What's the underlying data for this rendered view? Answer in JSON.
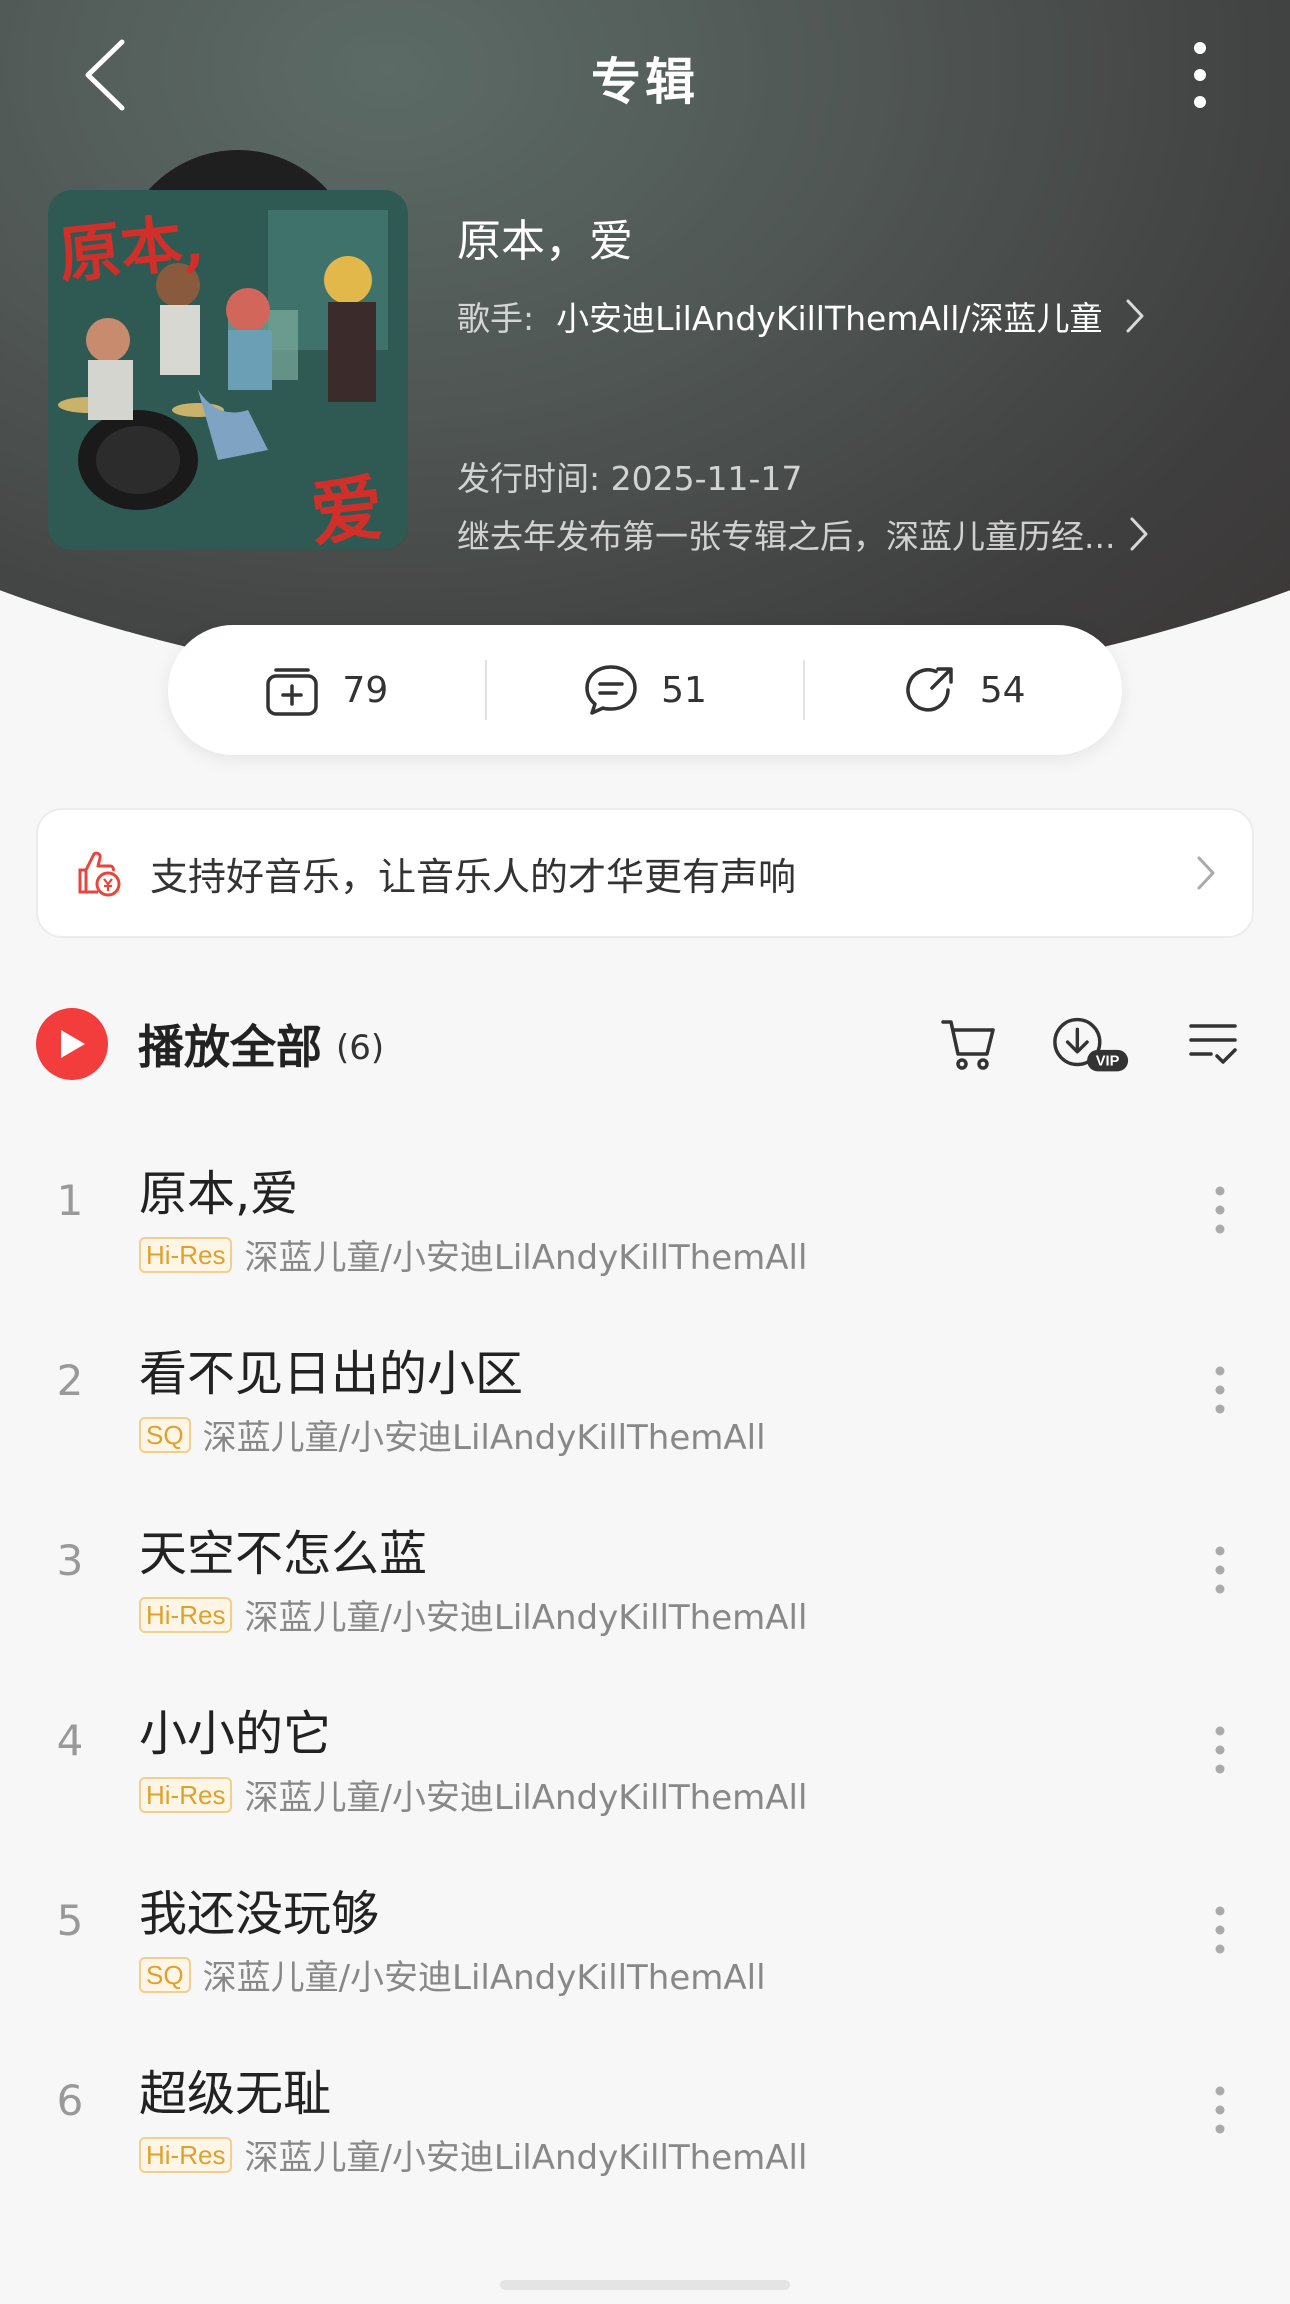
{
  "header": {
    "title": "专辑",
    "back_icon": "chevron-left-icon",
    "more_icon": "vertical-dots-icon"
  },
  "album": {
    "name": "原本，爱",
    "artist_label": "歌手:",
    "artists": "小安迪LilAndyKillThemAll/深蓝儿童",
    "release": "发行时间: 2025-11-17",
    "description": "继去年发布第一张专辑之后，深蓝儿童历经...",
    "cover_text": [
      "原本,",
      "爱"
    ]
  },
  "stats": {
    "collect_count": "79",
    "comment_count": "51",
    "share_count": "54"
  },
  "support": {
    "text": "支持好音乐，让音乐人的才华更有声响"
  },
  "playall": {
    "label": "播放全部",
    "count": "(6)"
  },
  "songs": [
    {
      "num": "1",
      "title": "原本,爱",
      "quality": "Hi-Res",
      "artist": "深蓝儿童/小安迪LilAndyKillThemAll"
    },
    {
      "num": "2",
      "title": "看不见日出的小区",
      "quality": "SQ",
      "artist": "深蓝儿童/小安迪LilAndyKillThemAll"
    },
    {
      "num": "3",
      "title": "天空不怎么蓝",
      "quality": "Hi-Res",
      "artist": "深蓝儿童/小安迪LilAndyKillThemAll"
    },
    {
      "num": "4",
      "title": "小小的它",
      "quality": "Hi-Res",
      "artist": "深蓝儿童/小安迪LilAndyKillThemAll"
    },
    {
      "num": "5",
      "title": "我还没玩够",
      "quality": "SQ",
      "artist": "深蓝儿童/小安迪LilAndyKillThemAll"
    },
    {
      "num": "6",
      "title": "超级无耻",
      "quality": "Hi-Res",
      "artist": "深蓝儿童/小安迪LilAndyKillThemAll"
    }
  ],
  "colors": {
    "accent_red": "#f33c3c",
    "quality_gold": "#e0a12b"
  }
}
